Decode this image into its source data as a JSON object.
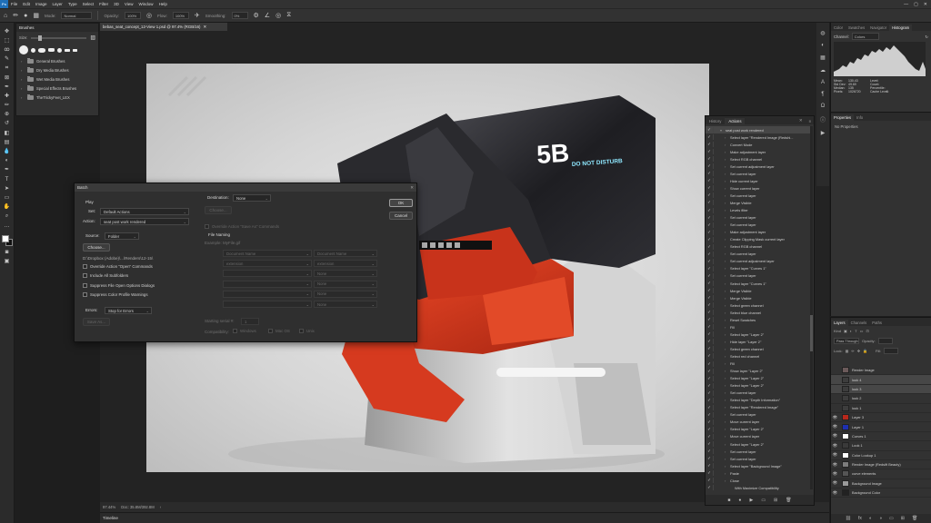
{
  "menu": [
    "File",
    "Edit",
    "Image",
    "Layer",
    "Type",
    "Select",
    "Filter",
    "3D",
    "View",
    "Window",
    "Help"
  ],
  "options_bar": {
    "mode_label": "Mode:",
    "mode_value": "Normal",
    "opacity_label": "Opacity:",
    "opacity_value": "100%",
    "flow_label": "Flow:",
    "flow_value": "100%",
    "smoothing_label": "Smoothing:",
    "smoothing_value": "0%"
  },
  "toolbar": {
    "tools": [
      "move-tool-icon",
      "marquee-tool-icon",
      "lasso-tool-icon",
      "quick-select-tool-icon",
      "crop-tool-icon",
      "frame-tool-icon",
      "eyedropper-tool-icon",
      "healing-brush-icon",
      "brush-tool-icon",
      "clone-stamp-icon",
      "history-brush-icon",
      "eraser-tool-icon",
      "gradient-tool-icon",
      "blur-tool-icon",
      "dodge-tool-icon",
      "pen-tool-icon",
      "type-tool-icon",
      "path-select-icon",
      "rectangle-tool-icon",
      "hand-tool-icon",
      "zoom-tool-icon",
      "more-tools-icon"
    ],
    "glyphs": [
      "✥",
      "⬚",
      "ꝏ",
      "✎",
      "⌗",
      "⊠",
      "✒",
      "✚",
      "✏",
      "⊕",
      "↺",
      "◧",
      "▤",
      "💧",
      "◐",
      "✒",
      "T",
      "➤",
      "▭",
      "✋",
      "⌕",
      "…"
    ]
  },
  "brushes_panel": {
    "tab": "Brushes",
    "size_label": "Size:",
    "folders": [
      "General Brushes",
      "Dry Media Brushes",
      "Wet Media Brushes",
      "Special Effects Brushes",
      "TheTrickyFeet_LEX"
    ]
  },
  "document": {
    "tab_title": "bebas_seat_concept_12-View 1.psd @ 97.4% (RGB/16)",
    "zoom": "97.44%",
    "doc_size": "Doc: 35.8M/392.8M",
    "timeline": "Timeline",
    "canvas_graphic": {
      "sign_text": "5B",
      "sign_subtext": "DO NOT DISTURB"
    }
  },
  "batch_dialog": {
    "title": "Batch",
    "play_label": "Play",
    "set_label": "Set:",
    "set_value": "Default Actions",
    "action_label": "Action:",
    "action_value": "seat post work rendered",
    "source_label": "Source:",
    "source_value": "Folder",
    "choose_label": "Choose...",
    "source_path": "D:\\Dropbox (Adobe)\\...\\Renders\\12-15\\",
    "checks": [
      "Override Action \"Open\" Commands",
      "Include All Subfolders",
      "Suppress File Open Options Dialogs",
      "Suppress Color Profile Warnings"
    ],
    "errors_label": "Errors:",
    "errors_value": "Stop for Errors",
    "save_as_label": "Save As...",
    "destination_label": "Destination:",
    "destination_value": "None",
    "dest_choose_label": "Choose...",
    "override_save_label": "Override Action \"Save As\" Commands",
    "file_naming_label": "File Naming",
    "example_label": "Example: MyFile.gif",
    "naming_fields": [
      [
        "Document Name",
        "Document Name"
      ],
      [
        "extension",
        "extension"
      ],
      [
        "",
        "None"
      ],
      [
        "",
        "None"
      ],
      [
        "",
        "None"
      ],
      [
        "",
        "None"
      ]
    ],
    "starting_serial_label": "Starting serial #:",
    "starting_serial_value": "1",
    "compatibility_label": "Compatibility:",
    "compat_windows": "Windows",
    "compat_mac": "Mac OS",
    "compat_unix": "Unix",
    "ok_label": "OK",
    "cancel_label": "Cancel"
  },
  "actions_panel": {
    "tabs": [
      "History",
      "Actions"
    ],
    "rows": [
      {
        "label": "seat post work rendered",
        "selected": true,
        "level": 0,
        "chev": "▾"
      },
      {
        "label": "Select layer \"Rendered Image (Redshi...",
        "selected": false,
        "level": 1,
        "chev": "›"
      },
      {
        "label": "Convert Mode",
        "selected": false,
        "level": 1,
        "chev": "›"
      },
      {
        "label": "Make adjustment layer",
        "selected": false,
        "level": 1,
        "chev": "›"
      },
      {
        "label": "Select RGB channel",
        "selected": false,
        "level": 1,
        "chev": "›"
      },
      {
        "label": "Set current adjustment layer",
        "selected": false,
        "level": 1,
        "chev": "›"
      },
      {
        "label": "Set current layer",
        "selected": false,
        "level": 1,
        "chev": "›"
      },
      {
        "label": "Hide current layer",
        "selected": false,
        "level": 1,
        "chev": "›"
      },
      {
        "label": "Show current layer",
        "selected": false,
        "level": 1,
        "chev": "›"
      },
      {
        "label": "Set current layer",
        "selected": false,
        "level": 1,
        "chev": "›"
      },
      {
        "label": "Merge Visible",
        "selected": false,
        "level": 1,
        "chev": "›"
      },
      {
        "label": "Levels filter",
        "selected": false,
        "level": 1,
        "chev": "›"
      },
      {
        "label": "Set current layer",
        "selected": false,
        "level": 1,
        "chev": "›"
      },
      {
        "label": "Set current layer",
        "selected": false,
        "level": 1,
        "chev": "›"
      },
      {
        "label": "Make adjustment layer",
        "selected": false,
        "level": 1,
        "chev": "›"
      },
      {
        "label": "Create Clipping Mask current layer",
        "selected": false,
        "level": 1,
        "chev": "›"
      },
      {
        "label": "Select RGB channel",
        "selected": false,
        "level": 1,
        "chev": "›"
      },
      {
        "label": "Set current layer",
        "selected": false,
        "level": 1,
        "chev": "›"
      },
      {
        "label": "Set current adjustment layer",
        "selected": false,
        "level": 1,
        "chev": "›"
      },
      {
        "label": "Select layer \"Curves 1\"",
        "selected": false,
        "level": 1,
        "chev": "›"
      },
      {
        "label": "Set current layer",
        "selected": false,
        "level": 1,
        "chev": "›"
      },
      {
        "label": "Select layer \"Curves 1\"",
        "selected": false,
        "level": 1,
        "chev": "›"
      },
      {
        "label": "Merge Visible",
        "selected": false,
        "level": 1,
        "chev": "›"
      },
      {
        "label": "Merge Visible",
        "selected": false,
        "level": 1,
        "chev": "›"
      },
      {
        "label": "Select green channel",
        "selected": false,
        "level": 1,
        "chev": "›"
      },
      {
        "label": "Select blue channel",
        "selected": false,
        "level": 1,
        "chev": "›"
      },
      {
        "label": "Reset Swatches",
        "selected": false,
        "level": 1,
        "chev": "›"
      },
      {
        "label": "Fill",
        "selected": false,
        "level": 1,
        "chev": "›"
      },
      {
        "label": "Select layer \"Layer 2\"",
        "selected": false,
        "level": 1,
        "chev": "›"
      },
      {
        "label": "Hide layer \"Layer 2\"",
        "selected": false,
        "level": 1,
        "chev": "›"
      },
      {
        "label": "Select green channel",
        "selected": false,
        "level": 1,
        "chev": "›"
      },
      {
        "label": "Select red channel",
        "selected": false,
        "level": 1,
        "chev": "›"
      },
      {
        "label": "Fill",
        "selected": false,
        "level": 1,
        "chev": "›"
      },
      {
        "label": "Show layer \"Layer 2\"",
        "selected": false,
        "level": 1,
        "chev": "›"
      },
      {
        "label": "Select layer \"Layer 2\"",
        "selected": false,
        "level": 1,
        "chev": "›"
      },
      {
        "label": "Select layer \"Layer 2\"",
        "selected": false,
        "level": 1,
        "chev": "›"
      },
      {
        "label": "Set current layer",
        "selected": false,
        "level": 1,
        "chev": "›"
      },
      {
        "label": "Select layer \"Depth Information\"",
        "selected": false,
        "level": 1,
        "chev": "›"
      },
      {
        "label": "Select layer \"Rendered Image\"",
        "selected": false,
        "level": 1,
        "chev": "›"
      },
      {
        "label": "Set current layer",
        "selected": false,
        "level": 1,
        "chev": "›"
      },
      {
        "label": "Move current layer",
        "selected": false,
        "level": 1,
        "chev": "›"
      },
      {
        "label": "Select layer \"Layer 2\"",
        "selected": false,
        "level": 1,
        "chev": "›"
      },
      {
        "label": "Move current layer",
        "selected": false,
        "level": 1,
        "chev": "›"
      },
      {
        "label": "Select layer \"Layer 2\"",
        "selected": false,
        "level": 1,
        "chev": "›"
      },
      {
        "label": "Set current layer",
        "selected": false,
        "level": 1,
        "chev": "›"
      },
      {
        "label": "Set current layer",
        "selected": false,
        "level": 1,
        "chev": "›"
      },
      {
        "label": "Select layer \"Background Image\"",
        "selected": false,
        "level": 1,
        "chev": "›"
      },
      {
        "label": "Paste",
        "selected": false,
        "level": 1,
        "chev": "›"
      },
      {
        "label": "Close",
        "selected": false,
        "level": 1,
        "chev": "›"
      },
      {
        "label": "With Maximize Compatibility",
        "selected": false,
        "level": 2,
        "chev": ""
      }
    ],
    "footer_icons": [
      "stop-icon",
      "record-icon",
      "play-icon",
      "new-set-icon",
      "new-action-icon",
      "delete-icon"
    ],
    "footer_glyphs": [
      "■",
      "●",
      "▶",
      "▭",
      "⊞",
      "🗑"
    ]
  },
  "histogram_panel": {
    "tabs": [
      "Color",
      "Swatches",
      "Navigator",
      "Histogram"
    ],
    "channel_label": "Channel:",
    "channel_value": "Colors",
    "stats": [
      [
        "Mean:",
        "130.43",
        "Level:",
        ""
      ],
      [
        "Std Dev:",
        "49.69",
        "Count:",
        ""
      ],
      [
        "Median:",
        "135",
        "Percentile:",
        ""
      ],
      [
        "Pixels:",
        "1026720",
        "Cache Level:",
        "1"
      ]
    ]
  },
  "properties_panel": {
    "tabs": [
      "Properties",
      "Info"
    ],
    "body": "No Properties"
  },
  "layers_panel": {
    "tabs": [
      "Layers",
      "Channels",
      "Paths"
    ],
    "kind_label": "Kind",
    "blend_value": "Pass Through",
    "opacity_label": "Opacity:",
    "fill_label": "Fill:",
    "lock_label": "Lock:",
    "rows": [
      {
        "name": "Render Image",
        "thumb": "#6b5a5a",
        "eye": "",
        "selected": false
      },
      {
        "name": "look 4",
        "thumb": "#3d3d3d",
        "eye": "",
        "selected": true
      },
      {
        "name": "look 3",
        "thumb": "#3d3d3d",
        "eye": "",
        "selected": true
      },
      {
        "name": "look 2",
        "thumb": "#3d3d3d",
        "eye": "",
        "selected": false
      },
      {
        "name": "look 1",
        "thumb": "#3d3d3d",
        "eye": "",
        "selected": false
      },
      {
        "name": "Layer 3",
        "thumb": "#b8281b",
        "eye": "👁",
        "selected": false
      },
      {
        "name": "Layer 1",
        "thumb": "#1d2fb0",
        "eye": "👁",
        "selected": false
      },
      {
        "name": "Curves 1",
        "thumb": "#ffffff",
        "eye": "👁",
        "selected": false
      },
      {
        "name": "Look 1",
        "thumb": "#3a3a3a",
        "eye": "👁",
        "selected": false
      },
      {
        "name": "Color Lookup 1",
        "thumb": "#ffffff",
        "eye": "👁",
        "selected": false
      },
      {
        "name": "Render Image (Redsift Beauty)",
        "thumb": "#7d7d7d",
        "eye": "👁",
        "selected": false
      },
      {
        "name": "curve elements",
        "thumb": "#555555",
        "eye": "👁",
        "selected": false
      },
      {
        "name": "Background Image",
        "thumb": "#9a9a9a",
        "eye": "👁",
        "selected": false
      },
      {
        "name": "Background Color",
        "thumb": "#222222",
        "eye": "👁",
        "selected": false
      }
    ],
    "footer_glyphs": [
      "⛓",
      "fx",
      "◐",
      "◑",
      "▭",
      "⊞",
      "🗑"
    ]
  },
  "colors": {
    "seat_red": "#d63a1f",
    "seat_shell": "#2a2a2e",
    "canvas_bg": "#d8d8d8"
  }
}
